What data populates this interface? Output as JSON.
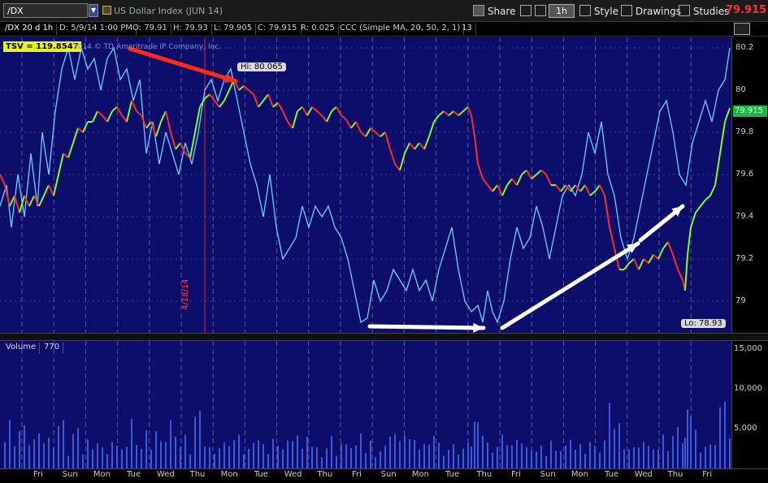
{
  "toolbar": {
    "symbol": "/DX",
    "title": "US Dollar Index (JUN 14)",
    "share_label": "Share",
    "period_label": "1h",
    "style_label": "Style",
    "drawings_label": "Drawings",
    "studies_label": "Studies",
    "last_price": "79.915"
  },
  "info": {
    "chart_name": "/DX 20 d 1h",
    "date": "D: 5/9/14 1:00 PM",
    "open": "O: 79.91",
    "high": "H: 79.93",
    "low": "L: 79.905",
    "close": "C: 79.915",
    "range": "R: 0.025",
    "study": "CCC (Simple MA, 20, 50, 2, 1)",
    "study_value": "13"
  },
  "tsv": "TSV = 119.8547",
  "copyright": "2014 © TD Ameritrade IP Company, Inc.",
  "hi_label": "Hi: 80.065",
  "lo_label": "Lo: 78.93",
  "vertical_date": "4/18/14",
  "price_tag": "79.915",
  "volume": {
    "label": "Volume",
    "value": "770"
  },
  "colors": {
    "background": "#0d0d6b",
    "up": "#7cff2a",
    "down": "#ff2a2a",
    "indicator": "#6ad0ff",
    "last_price": "#ff3030",
    "arrow_red": "#ff2a1a",
    "arrow_white": "#ffffff"
  },
  "chart_data": {
    "type": "line",
    "price_axis": [
      "80.2",
      "80",
      "79.8",
      "79.6",
      "79.4",
      "79.2",
      "79"
    ],
    "price_ylim": [
      78.85,
      80.25
    ],
    "volume_axis": [
      "15,000",
      "10,000",
      "5,000"
    ],
    "volume_ylim": [
      0,
      16000
    ],
    "time_labels": [
      "Fri",
      "Sun",
      "Mon",
      "Tue",
      "Wed",
      "Thu",
      "Mon",
      "Tue",
      "Wed",
      "Thu",
      "Fri",
      "Sun",
      "Mon",
      "Tue",
      "Thu",
      "Fri",
      "Sun",
      "Mon",
      "Tue",
      "Wed",
      "Thu",
      "Fri"
    ],
    "price_path": [
      [
        0,
        79.6
      ],
      [
        6,
        79.55
      ],
      [
        12,
        79.45
      ],
      [
        18,
        79.5
      ],
      [
        24,
        79.42
      ],
      [
        30,
        79.5
      ],
      [
        36,
        79.45
      ],
      [
        42,
        79.5
      ],
      [
        48,
        79.45
      ],
      [
        54,
        79.5
      ],
      [
        60,
        79.55
      ],
      [
        66,
        79.5
      ],
      [
        72,
        79.6
      ],
      [
        78,
        79.7
      ],
      [
        84,
        79.68
      ],
      [
        90,
        79.75
      ],
      [
        96,
        79.82
      ],
      [
        102,
        79.8
      ],
      [
        108,
        79.85
      ],
      [
        114,
        79.85
      ],
      [
        120,
        79.9
      ],
      [
        126,
        79.88
      ],
      [
        132,
        79.85
      ],
      [
        138,
        79.9
      ],
      [
        144,
        79.92
      ],
      [
        150,
        79.88
      ],
      [
        156,
        79.85
      ],
      [
        162,
        79.95
      ],
      [
        168,
        79.9
      ],
      [
        174,
        79.88
      ],
      [
        180,
        79.82
      ],
      [
        186,
        79.85
      ],
      [
        192,
        79.78
      ],
      [
        198,
        79.85
      ],
      [
        204,
        79.9
      ],
      [
        210,
        79.8
      ],
      [
        216,
        79.72
      ],
      [
        222,
        79.75
      ],
      [
        228,
        79.7
      ],
      [
        234,
        79.68
      ],
      [
        240,
        79.8
      ],
      [
        246,
        79.92
      ],
      [
        252,
        79.96
      ],
      [
        258,
        79.98
      ],
      [
        264,
        79.95
      ],
      [
        270,
        79.92
      ],
      [
        276,
        79.95
      ],
      [
        282,
        80.0
      ],
      [
        288,
        80.05
      ],
      [
        294,
        80.0
      ],
      [
        300,
        80.02
      ],
      [
        306,
        80.0
      ],
      [
        312,
        79.98
      ],
      [
        318,
        79.92
      ],
      [
        324,
        79.95
      ],
      [
        330,
        79.98
      ],
      [
        336,
        79.92
      ],
      [
        342,
        79.94
      ],
      [
        348,
        79.9
      ],
      [
        354,
        79.85
      ],
      [
        360,
        79.82
      ],
      [
        366,
        79.9
      ],
      [
        372,
        79.92
      ],
      [
        378,
        79.88
      ],
      [
        384,
        79.92
      ],
      [
        390,
        79.9
      ],
      [
        396,
        79.88
      ],
      [
        402,
        79.85
      ],
      [
        408,
        79.9
      ],
      [
        414,
        79.92
      ],
      [
        420,
        79.88
      ],
      [
        426,
        79.86
      ],
      [
        432,
        79.82
      ],
      [
        438,
        79.85
      ],
      [
        444,
        79.8
      ],
      [
        450,
        79.78
      ],
      [
        456,
        79.82
      ],
      [
        462,
        79.8
      ],
      [
        468,
        79.78
      ],
      [
        474,
        79.8
      ],
      [
        480,
        79.72
      ],
      [
        486,
        79.65
      ],
      [
        492,
        79.62
      ],
      [
        498,
        79.7
      ],
      [
        504,
        79.75
      ],
      [
        510,
        79.72
      ],
      [
        516,
        79.75
      ],
      [
        522,
        79.72
      ],
      [
        528,
        79.78
      ],
      [
        534,
        79.85
      ],
      [
        540,
        79.88
      ],
      [
        546,
        79.9
      ],
      [
        552,
        79.88
      ],
      [
        558,
        79.9
      ],
      [
        564,
        79.88
      ],
      [
        570,
        79.9
      ],
      [
        576,
        79.92
      ],
      [
        580,
        79.88
      ],
      [
        584,
        79.78
      ],
      [
        588,
        79.65
      ],
      [
        594,
        79.58
      ],
      [
        600,
        79.55
      ],
      [
        606,
        79.52
      ],
      [
        612,
        79.55
      ],
      [
        618,
        79.5
      ],
      [
        624,
        79.55
      ],
      [
        630,
        79.58
      ],
      [
        636,
        79.55
      ],
      [
        642,
        79.6
      ],
      [
        648,
        79.62
      ],
      [
        654,
        79.58
      ],
      [
        660,
        79.6
      ],
      [
        666,
        79.62
      ],
      [
        672,
        79.6
      ],
      [
        678,
        79.55
      ],
      [
        684,
        79.55
      ],
      [
        690,
        79.52
      ],
      [
        696,
        79.55
      ],
      [
        702,
        79.52
      ],
      [
        708,
        79.55
      ],
      [
        714,
        79.52
      ],
      [
        720,
        79.55
      ],
      [
        726,
        79.5
      ],
      [
        732,
        79.52
      ],
      [
        738,
        79.55
      ],
      [
        744,
        79.5
      ],
      [
        750,
        79.35
      ],
      [
        756,
        79.25
      ],
      [
        762,
        79.15
      ],
      [
        768,
        79.15
      ],
      [
        774,
        79.18
      ],
      [
        780,
        79.2
      ],
      [
        786,
        79.15
      ],
      [
        792,
        79.2
      ],
      [
        798,
        79.18
      ],
      [
        804,
        79.22
      ],
      [
        810,
        79.2
      ],
      [
        816,
        79.25
      ],
      [
        822,
        79.28
      ],
      [
        828,
        79.22
      ],
      [
        834,
        79.15
      ],
      [
        840,
        79.1
      ],
      [
        843,
        79.05
      ],
      [
        846,
        79.22
      ],
      [
        850,
        79.35
      ],
      [
        856,
        79.42
      ],
      [
        862,
        79.45
      ],
      [
        868,
        79.48
      ],
      [
        874,
        79.5
      ],
      [
        880,
        79.55
      ],
      [
        886,
        79.7
      ],
      [
        892,
        79.85
      ],
      [
        898,
        79.915
      ]
    ],
    "indicator_path": [
      [
        0,
        79.45
      ],
      [
        8,
        79.55
      ],
      [
        14,
        79.35
      ],
      [
        22,
        79.6
      ],
      [
        30,
        79.4
      ],
      [
        38,
        79.7
      ],
      [
        46,
        79.45
      ],
      [
        52,
        79.8
      ],
      [
        60,
        79.6
      ],
      [
        68,
        79.9
      ],
      [
        76,
        80.1
      ],
      [
        84,
        80.2
      ],
      [
        92,
        80.05
      ],
      [
        100,
        80.2
      ],
      [
        108,
        80.1
      ],
      [
        116,
        80.15
      ],
      [
        124,
        80.0
      ],
      [
        132,
        80.15
      ],
      [
        140,
        80.2
      ],
      [
        148,
        80.05
      ],
      [
        156,
        80.1
      ],
      [
        164,
        79.95
      ],
      [
        172,
        80.05
      ],
      [
        180,
        79.7
      ],
      [
        188,
        79.85
      ],
      [
        196,
        79.65
      ],
      [
        204,
        79.8
      ],
      [
        212,
        79.7
      ],
      [
        220,
        79.6
      ],
      [
        228,
        79.75
      ],
      [
        236,
        79.65
      ],
      [
        244,
        79.8
      ],
      [
        252,
        80.0
      ],
      [
        260,
        80.05
      ],
      [
        268,
        79.95
      ],
      [
        276,
        80.05
      ],
      [
        284,
        80.1
      ],
      [
        292,
        79.95
      ],
      [
        300,
        79.8
      ],
      [
        308,
        79.65
      ],
      [
        316,
        79.55
      ],
      [
        324,
        79.4
      ],
      [
        332,
        79.6
      ],
      [
        340,
        79.35
      ],
      [
        348,
        79.2
      ],
      [
        356,
        79.25
      ],
      [
        364,
        79.3
      ],
      [
        372,
        79.45
      ],
      [
        380,
        79.35
      ],
      [
        388,
        79.45
      ],
      [
        396,
        79.4
      ],
      [
        404,
        79.45
      ],
      [
        412,
        79.35
      ],
      [
        420,
        79.3
      ],
      [
        428,
        79.2
      ],
      [
        436,
        79.05
      ],
      [
        444,
        78.9
      ],
      [
        452,
        78.92
      ],
      [
        460,
        79.1
      ],
      [
        468,
        79.0
      ],
      [
        476,
        79.05
      ],
      [
        484,
        79.15
      ],
      [
        492,
        79.1
      ],
      [
        500,
        79.05
      ],
      [
        508,
        79.15
      ],
      [
        516,
        79.05
      ],
      [
        524,
        79.1
      ],
      [
        532,
        79.0
      ],
      [
        540,
        79.15
      ],
      [
        548,
        79.25
      ],
      [
        556,
        79.35
      ],
      [
        564,
        79.15
      ],
      [
        572,
        79.0
      ],
      [
        580,
        78.95
      ],
      [
        588,
        78.98
      ],
      [
        594,
        78.9
      ],
      [
        600,
        79.05
      ],
      [
        606,
        78.95
      ],
      [
        612,
        78.9
      ],
      [
        620,
        79.0
      ],
      [
        628,
        79.2
      ],
      [
        636,
        79.35
      ],
      [
        644,
        79.25
      ],
      [
        652,
        79.3
      ],
      [
        660,
        79.45
      ],
      [
        668,
        79.35
      ],
      [
        676,
        79.2
      ],
      [
        684,
        79.35
      ],
      [
        692,
        79.5
      ],
      [
        700,
        79.55
      ],
      [
        708,
        79.5
      ],
      [
        716,
        79.6
      ],
      [
        724,
        79.8
      ],
      [
        732,
        79.7
      ],
      [
        740,
        79.85
      ],
      [
        748,
        79.6
      ],
      [
        756,
        79.5
      ],
      [
        764,
        79.3
      ],
      [
        772,
        79.2
      ],
      [
        780,
        79.3
      ],
      [
        788,
        79.45
      ],
      [
        796,
        79.6
      ],
      [
        804,
        79.75
      ],
      [
        812,
        79.9
      ],
      [
        820,
        79.95
      ],
      [
        828,
        79.8
      ],
      [
        836,
        79.6
      ],
      [
        844,
        79.55
      ],
      [
        852,
        79.75
      ],
      [
        860,
        79.85
      ],
      [
        868,
        79.95
      ],
      [
        876,
        79.85
      ],
      [
        884,
        80.0
      ],
      [
        892,
        80.05
      ],
      [
        898,
        80.2
      ]
    ]
  }
}
